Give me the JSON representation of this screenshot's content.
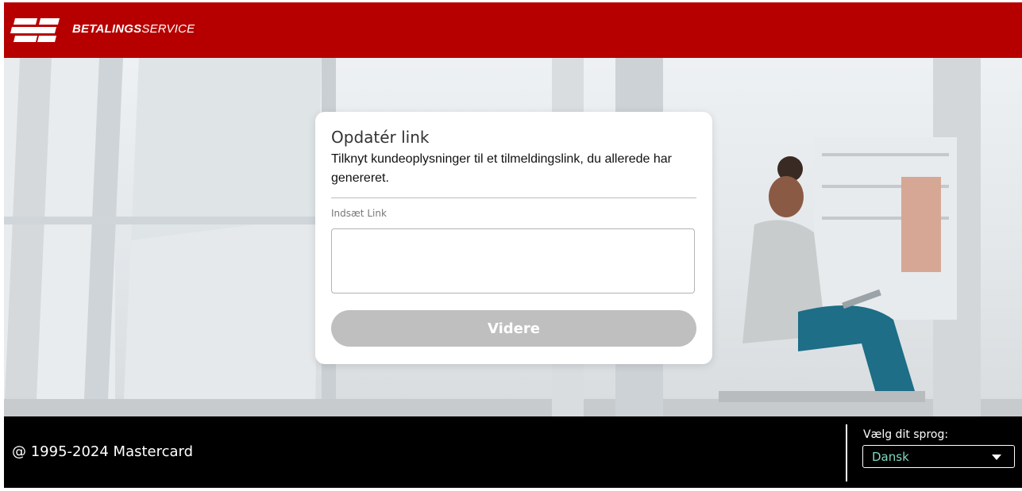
{
  "header": {
    "brand_bold": "BETALINGS",
    "brand_light": "SERVICE",
    "logo_icon": "betalingsservice-logo-icon",
    "brand_color": "#b60000"
  },
  "card": {
    "title": "Opdatér link",
    "description": "Tilknyt kundeoplysninger til et tilmeldingslink, du allerede har genereret.",
    "field_label": "Indsæt Link",
    "field_value": "",
    "button_label": "Videre",
    "button_color": "#bfbfbf"
  },
  "footer": {
    "copyright": "@ 1995-2024 Mastercard",
    "language_label": "Vælg dit sprog:",
    "language_selected": "Dansk",
    "language_icon": "chevron-down-icon",
    "accent_color": "#7fd9c0"
  }
}
